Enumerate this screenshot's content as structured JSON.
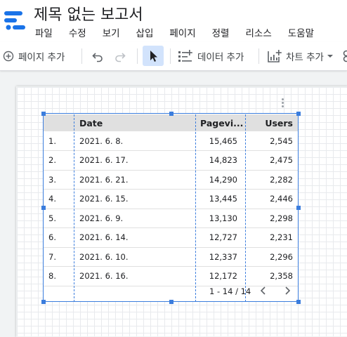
{
  "app": {
    "doc_title": "제목 없는 보고서",
    "menu": [
      "파일",
      "수정",
      "보기",
      "삽입",
      "페이지",
      "정렬",
      "리소스",
      "도움말"
    ]
  },
  "toolbar": {
    "add_page": "페이지 추가",
    "add_data": "데이터 추가",
    "add_chart": "차트 추가",
    "accent_color": "#1a73e8"
  },
  "table": {
    "columns": [
      "",
      "Date",
      "Pagevi...",
      "Users"
    ],
    "rows": [
      {
        "idx": "1.",
        "date": "2021. 6. 8.",
        "pageviews": "15,465",
        "users": "2,545"
      },
      {
        "idx": "2.",
        "date": "2021. 6. 17.",
        "pageviews": "14,823",
        "users": "2,475"
      },
      {
        "idx": "3.",
        "date": "2021. 6. 21.",
        "pageviews": "14,290",
        "users": "2,282"
      },
      {
        "idx": "4.",
        "date": "2021. 6. 15.",
        "pageviews": "13,445",
        "users": "2,446"
      },
      {
        "idx": "5.",
        "date": "2021. 6. 9.",
        "pageviews": "13,130",
        "users": "2,298"
      },
      {
        "idx": "6.",
        "date": "2021. 6. 14.",
        "pageviews": "12,727",
        "users": "2,231"
      },
      {
        "idx": "7.",
        "date": "2021. 6. 10.",
        "pageviews": "12,337",
        "users": "2,296"
      },
      {
        "idx": "8.",
        "date": "2021. 6. 16.",
        "pageviews": "12,172",
        "users": "2,358"
      }
    ],
    "pagination": "1 - 14 / 14",
    "selection_color": "#3b7ddd"
  }
}
